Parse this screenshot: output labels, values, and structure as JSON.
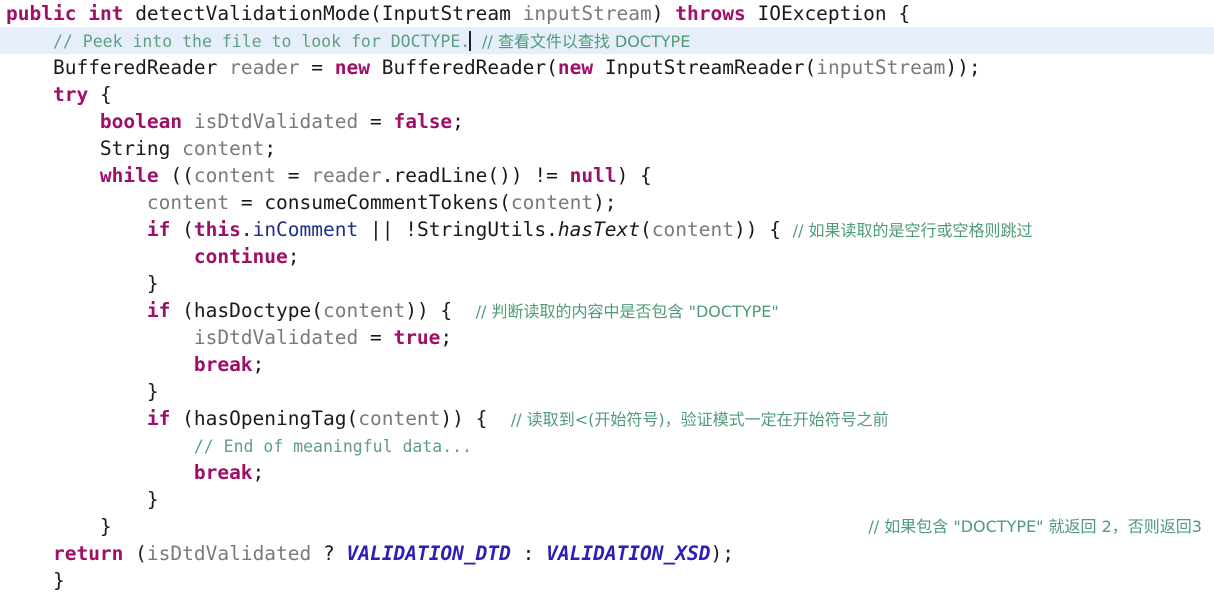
{
  "editor": {
    "language": "java",
    "colors": {
      "background": "#ffffff",
      "keyword": "#9e1068",
      "identifier": "#7a7a7a",
      "field": "#1d2f8c",
      "constant": "#2b1fb5",
      "comment": "#5f9e7e",
      "highlight_line_background": "#e6eefb",
      "caret": "#202020"
    },
    "highlighted_line_number": 2,
    "caret_line_text_before": "// Peek into the file to look for DOCTYPE."
  },
  "code": {
    "lines": [
      {
        "n": 1,
        "indent": 0,
        "highlight": false,
        "tokens": [
          {
            "t": "public",
            "c": "kw"
          },
          {
            "t": " ",
            "c": "punct"
          },
          {
            "t": "int",
            "c": "kw"
          },
          {
            "t": " ",
            "c": "punct"
          },
          {
            "t": "detectValidationMode",
            "c": "method"
          },
          {
            "t": "(",
            "c": "punct"
          },
          {
            "t": "InputStream",
            "c": "type"
          },
          {
            "t": " ",
            "c": "punct"
          },
          {
            "t": "inputStream",
            "c": "ident"
          },
          {
            "t": ")",
            "c": "punct"
          },
          {
            "t": " ",
            "c": "punct"
          },
          {
            "t": "throws",
            "c": "kw"
          },
          {
            "t": " ",
            "c": "punct"
          },
          {
            "t": "IOException",
            "c": "type"
          },
          {
            "t": " {",
            "c": "punct"
          }
        ]
      },
      {
        "n": 2,
        "indent": 1,
        "highlight": true,
        "tokens": [
          {
            "t": "// Peek into the file to look for DOCTYPE.",
            "c": "cmt"
          },
          {
            "t": "CARET",
            "c": "caret"
          },
          {
            "t": " ",
            "c": "punct"
          },
          {
            "t": "// 查看文件以查找 DOCTYPE",
            "c": "cmt-cn"
          }
        ]
      },
      {
        "n": 3,
        "indent": 1,
        "highlight": false,
        "tokens": [
          {
            "t": "BufferedReader",
            "c": "type"
          },
          {
            "t": " ",
            "c": "punct"
          },
          {
            "t": "reader",
            "c": "ident"
          },
          {
            "t": " = ",
            "c": "punct"
          },
          {
            "t": "new",
            "c": "kw"
          },
          {
            "t": " ",
            "c": "punct"
          },
          {
            "t": "BufferedReader",
            "c": "type"
          },
          {
            "t": "(",
            "c": "punct"
          },
          {
            "t": "new",
            "c": "kw"
          },
          {
            "t": " ",
            "c": "punct"
          },
          {
            "t": "InputStreamReader",
            "c": "type"
          },
          {
            "t": "(",
            "c": "punct"
          },
          {
            "t": "inputStream",
            "c": "ident"
          },
          {
            "t": "));",
            "c": "punct"
          }
        ]
      },
      {
        "n": 4,
        "indent": 1,
        "highlight": false,
        "tokens": [
          {
            "t": "try",
            "c": "kw"
          },
          {
            "t": " {",
            "c": "punct"
          }
        ]
      },
      {
        "n": 5,
        "indent": 2,
        "highlight": false,
        "tokens": [
          {
            "t": "boolean",
            "c": "kw"
          },
          {
            "t": " ",
            "c": "punct"
          },
          {
            "t": "isDtdValidated",
            "c": "ident"
          },
          {
            "t": " = ",
            "c": "punct"
          },
          {
            "t": "false",
            "c": "kw"
          },
          {
            "t": ";",
            "c": "punct"
          }
        ]
      },
      {
        "n": 6,
        "indent": 2,
        "highlight": false,
        "tokens": [
          {
            "t": "String",
            "c": "type"
          },
          {
            "t": " ",
            "c": "punct"
          },
          {
            "t": "content",
            "c": "ident"
          },
          {
            "t": ";",
            "c": "punct"
          }
        ]
      },
      {
        "n": 7,
        "indent": 2,
        "highlight": false,
        "tokens": [
          {
            "t": "while",
            "c": "kw"
          },
          {
            "t": " ((",
            "c": "punct"
          },
          {
            "t": "content",
            "c": "ident"
          },
          {
            "t": " = ",
            "c": "punct"
          },
          {
            "t": "reader",
            "c": "ident"
          },
          {
            "t": ".",
            "c": "punct"
          },
          {
            "t": "readLine",
            "c": "method"
          },
          {
            "t": "()) != ",
            "c": "punct"
          },
          {
            "t": "null",
            "c": "kw"
          },
          {
            "t": ") {",
            "c": "punct"
          }
        ]
      },
      {
        "n": 8,
        "indent": 3,
        "highlight": false,
        "tokens": [
          {
            "t": "content",
            "c": "ident"
          },
          {
            "t": " = ",
            "c": "punct"
          },
          {
            "t": "consumeCommentTokens",
            "c": "method"
          },
          {
            "t": "(",
            "c": "punct"
          },
          {
            "t": "content",
            "c": "ident"
          },
          {
            "t": ");",
            "c": "punct"
          }
        ]
      },
      {
        "n": 9,
        "indent": 3,
        "highlight": false,
        "tokens": [
          {
            "t": "if",
            "c": "kw"
          },
          {
            "t": " (",
            "c": "punct"
          },
          {
            "t": "this",
            "c": "kw"
          },
          {
            "t": ".",
            "c": "punct"
          },
          {
            "t": "inComment",
            "c": "field"
          },
          {
            "t": " || !",
            "c": "punct"
          },
          {
            "t": "StringUtils",
            "c": "type"
          },
          {
            "t": ".",
            "c": "punct"
          },
          {
            "t": "hasText",
            "c": "methodi"
          },
          {
            "t": "(",
            "c": "punct"
          },
          {
            "t": "content",
            "c": "ident"
          },
          {
            "t": ")) { ",
            "c": "punct"
          },
          {
            "t": "// 如果读取的是空行或空格则跳过",
            "c": "cmt-cn"
          }
        ]
      },
      {
        "n": 10,
        "indent": 4,
        "highlight": false,
        "tokens": [
          {
            "t": "continue",
            "c": "kw"
          },
          {
            "t": ";",
            "c": "punct"
          }
        ]
      },
      {
        "n": 11,
        "indent": 3,
        "highlight": false,
        "tokens": [
          {
            "t": "}",
            "c": "punct"
          }
        ]
      },
      {
        "n": 12,
        "indent": 3,
        "highlight": false,
        "tokens": [
          {
            "t": "if",
            "c": "kw"
          },
          {
            "t": " (",
            "c": "punct"
          },
          {
            "t": "hasDoctype",
            "c": "method"
          },
          {
            "t": "(",
            "c": "punct"
          },
          {
            "t": "content",
            "c": "ident"
          },
          {
            "t": ")) {  ",
            "c": "punct"
          },
          {
            "t": "// 判断读取的内容中是否包含 \"DOCTYPE\"",
            "c": "cmt-cn"
          }
        ]
      },
      {
        "n": 13,
        "indent": 4,
        "highlight": false,
        "tokens": [
          {
            "t": "isDtdValidated",
            "c": "ident"
          },
          {
            "t": " = ",
            "c": "punct"
          },
          {
            "t": "true",
            "c": "kw"
          },
          {
            "t": ";",
            "c": "punct"
          }
        ]
      },
      {
        "n": 14,
        "indent": 4,
        "highlight": false,
        "tokens": [
          {
            "t": "break",
            "c": "kw"
          },
          {
            "t": ";",
            "c": "punct"
          }
        ]
      },
      {
        "n": 15,
        "indent": 3,
        "highlight": false,
        "tokens": [
          {
            "t": "}",
            "c": "punct"
          }
        ]
      },
      {
        "n": 16,
        "indent": 3,
        "highlight": false,
        "tokens": [
          {
            "t": "if",
            "c": "kw"
          },
          {
            "t": " (",
            "c": "punct"
          },
          {
            "t": "hasOpeningTag",
            "c": "method"
          },
          {
            "t": "(",
            "c": "punct"
          },
          {
            "t": "content",
            "c": "ident"
          },
          {
            "t": ")) {  ",
            "c": "punct"
          },
          {
            "t": "// 读取到<(开始符号)，验证模式一定在开始符号之前",
            "c": "cmt-cn"
          }
        ]
      },
      {
        "n": 17,
        "indent": 4,
        "highlight": false,
        "tokens": [
          {
            "t": "// End of meaningful data...",
            "c": "cmt"
          }
        ]
      },
      {
        "n": 18,
        "indent": 4,
        "highlight": false,
        "tokens": [
          {
            "t": "break",
            "c": "kw"
          },
          {
            "t": ";",
            "c": "punct"
          }
        ]
      },
      {
        "n": 19,
        "indent": 3,
        "highlight": false,
        "tokens": [
          {
            "t": "}",
            "c": "punct"
          }
        ]
      },
      {
        "n": 20,
        "indent": 2,
        "highlight": false,
        "tokens": [
          {
            "t": "}",
            "c": "punct"
          },
          {
            "t": "RIGHT:// 如果包含 \"DOCTYPE\" 就返回 2，否则返回3",
            "c": "cmt-cn"
          }
        ]
      },
      {
        "n": 21,
        "indent": 1,
        "highlight": false,
        "tokens": [
          {
            "t": "return",
            "c": "kw"
          },
          {
            "t": " (",
            "c": "punct"
          },
          {
            "t": "isDtdValidated",
            "c": "ident"
          },
          {
            "t": " ? ",
            "c": "punct"
          },
          {
            "t": "VALIDATION_DTD",
            "c": "const"
          },
          {
            "t": " : ",
            "c": "punct"
          },
          {
            "t": "VALIDATION_XSD",
            "c": "const"
          },
          {
            "t": ");",
            "c": "punct"
          }
        ]
      },
      {
        "n": 22,
        "indent": 1,
        "highlight": false,
        "tokens": [
          {
            "t": "}",
            "c": "punct"
          }
        ]
      }
    ]
  }
}
